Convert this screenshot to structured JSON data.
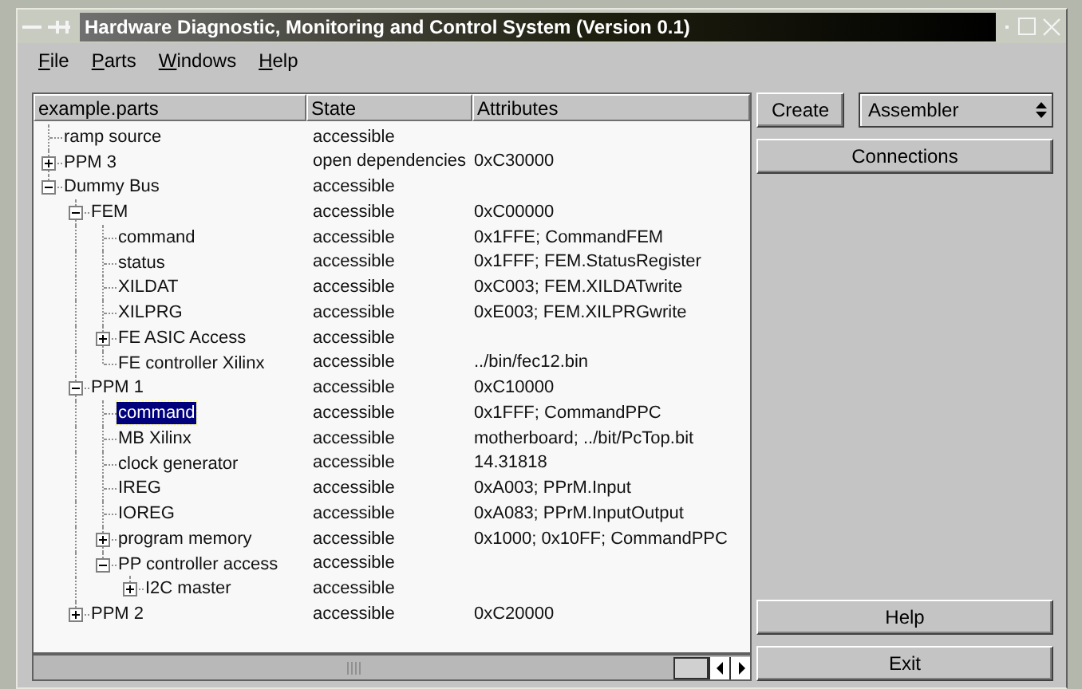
{
  "window": {
    "title": "Hardware Diagnostic, Monitoring and Control System (Version 0.1)"
  },
  "menu": [
    "File",
    "Parts",
    "Windows",
    "Help"
  ],
  "tree": {
    "columns": [
      "example.parts",
      "State",
      "Attributes"
    ],
    "rows": [
      {
        "name": "ramp source",
        "state": "accessible",
        "selected": false
      },
      {
        "name": "PPM 3",
        "state": "open dependencies",
        "attributes": "0xC30000",
        "expanded": false,
        "selected": false
      },
      {
        "name": "Dummy Bus",
        "state": "accessible",
        "expanded": true,
        "selected": false,
        "children": [
          {
            "name": "FEM",
            "state": "accessible",
            "attributes": "0xC00000",
            "expanded": true,
            "selected": false,
            "children": [
              {
                "name": "command",
                "state": "accessible",
                "attributes": "0x1FFE; CommandFEM",
                "selected": false
              },
              {
                "name": "status",
                "state": "accessible",
                "attributes": "0x1FFF; FEM.StatusRegister",
                "selected": false
              },
              {
                "name": "XILDAT",
                "state": "accessible",
                "attributes": "0xC003; FEM.XILDATwrite",
                "selected": false
              },
              {
                "name": "XILPRG",
                "state": "accessible",
                "attributes": "0xE003; FEM.XILPRGwrite",
                "selected": false
              },
              {
                "name": "FE ASIC Access",
                "state": "accessible",
                "expanded": false,
                "selected": false
              },
              {
                "name": "FE controller Xilinx",
                "state": "accessible",
                "attributes": "../bin/fec12.bin",
                "selected": false
              }
            ]
          },
          {
            "name": "PPM 1",
            "state": "accessible",
            "attributes": "0xC10000",
            "expanded": true,
            "selected": false,
            "children": [
              {
                "name": "command",
                "state": "accessible",
                "attributes": "0x1FFF; CommandPPC",
                "selected": true
              },
              {
                "name": "MB Xilinx",
                "state": "accessible",
                "attributes": "motherboard; ../bit/PcTop.bit",
                "selected": false
              },
              {
                "name": "clock generator",
                "state": "accessible",
                "attributes": "14.31818",
                "selected": false
              },
              {
                "name": "IREG",
                "state": "accessible",
                "attributes": "0xA003; PPrM.Input",
                "selected": false
              },
              {
                "name": "IOREG",
                "state": "accessible",
                "attributes": "0xA083; PPrM.InputOutput",
                "selected": false
              },
              {
                "name": "program memory",
                "state": "accessible",
                "attributes": "0x1000; 0x10FF; CommandPPC",
                "expanded": false,
                "selected": false
              },
              {
                "name": "PP controller access",
                "state": "accessible",
                "expanded": true,
                "selected": false,
                "children": [
                  {
                    "name": "I2C master",
                    "state": "accessible",
                    "expanded": false,
                    "selected": false
                  }
                ]
              }
            ]
          },
          {
            "name": "PPM 2",
            "state": "accessible",
            "attributes": "0xC20000",
            "expanded": false,
            "selected": false
          }
        ]
      }
    ]
  },
  "side_panel": {
    "create": "Create",
    "select_value": "Assembler",
    "connections": "Connections",
    "help": "Help",
    "exit": "Exit"
  }
}
